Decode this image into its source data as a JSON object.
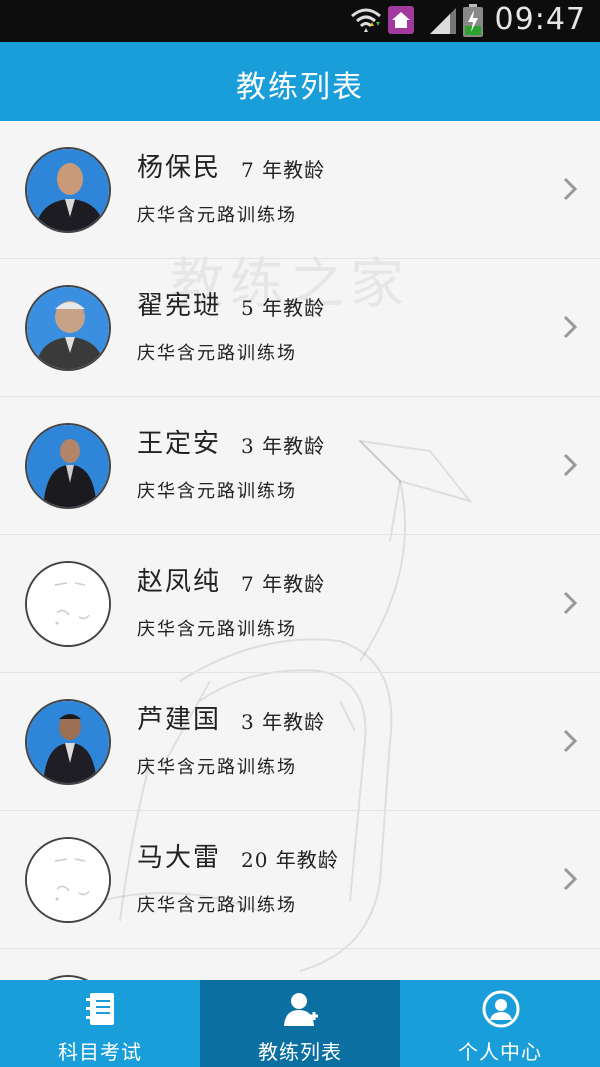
{
  "status_bar": {
    "time": "09:47"
  },
  "header": {
    "title": "教练列表"
  },
  "watermark": {
    "text": "教练之家"
  },
  "coaches": [
    {
      "name": "杨保民",
      "years": "7 年教龄",
      "location": "庆华含元路训练场",
      "has_photo": true
    },
    {
      "name": "翟宪琎",
      "years": "5 年教龄",
      "location": "庆华含元路训练场",
      "has_photo": true
    },
    {
      "name": "王定安",
      "years": "3 年教龄",
      "location": "庆华含元路训练场",
      "has_photo": true
    },
    {
      "name": "赵凤纯",
      "years": "7 年教龄",
      "location": "庆华含元路训练场",
      "has_photo": false
    },
    {
      "name": "芦建国",
      "years": "3 年教龄",
      "location": "庆华含元路训练场",
      "has_photo": true
    },
    {
      "name": "马大雷",
      "years": "20 年教龄",
      "location": "庆华含元路训练场",
      "has_photo": false
    }
  ],
  "tabs": [
    {
      "label": "科目考试",
      "icon": "notebook-icon",
      "active": false
    },
    {
      "label": "教练列表",
      "icon": "coach-user-icon",
      "active": true
    },
    {
      "label": "个人中心",
      "icon": "profile-circle-icon",
      "active": false
    }
  ],
  "colors": {
    "brand": "#1a9ed9",
    "active_tab": "#0b6fa2"
  }
}
